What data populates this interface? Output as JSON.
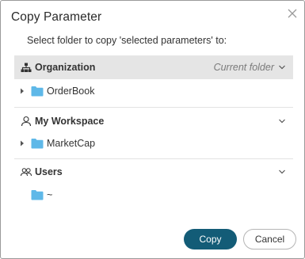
{
  "dialog": {
    "title": "Copy Parameter",
    "subtitle": "Select folder to copy 'selected parameters' to:"
  },
  "sections": [
    {
      "label": "Organization",
      "icon": "org-hierarchy-icon",
      "current_label": "Current folder",
      "selected": true,
      "items": [
        {
          "label": "OrderBook",
          "expandable": true
        }
      ]
    },
    {
      "label": "My Workspace",
      "icon": "user-icon",
      "items": [
        {
          "label": "MarketCap",
          "expandable": true
        }
      ]
    },
    {
      "label": "Users",
      "icon": "users-icon",
      "items": [
        {
          "label": "~",
          "expandable": false
        }
      ]
    }
  ],
  "buttons": {
    "copy": "Copy",
    "cancel": "Cancel"
  },
  "colors": {
    "primary": "#135c77",
    "folder": "#5eb8e8",
    "selected_bg": "#e5e5e5"
  }
}
